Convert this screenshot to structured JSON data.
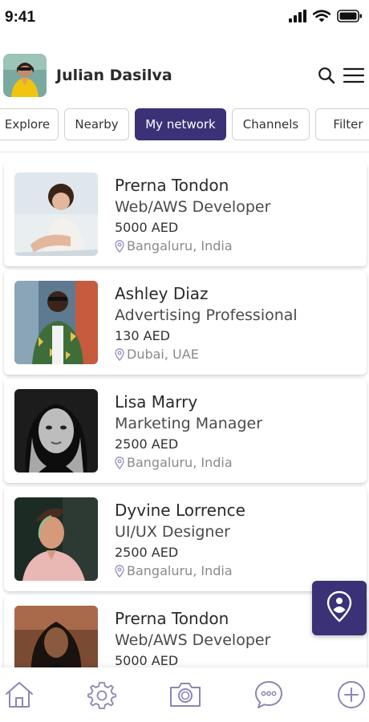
{
  "status_bar": {
    "time": "9:41"
  },
  "header": {
    "user_name": "Julian Dasilva",
    "icons": [
      "search-icon",
      "menu-icon"
    ]
  },
  "tabs": [
    {
      "label": "Explore",
      "active": false
    },
    {
      "label": "Nearby",
      "active": false
    },
    {
      "label": "My network",
      "active": true
    },
    {
      "label": "Channels",
      "active": false
    },
    {
      "label": "Filter",
      "active": false
    }
  ],
  "profiles": [
    {
      "name": "Prerna Tondon",
      "role": "Web/AWS Developer",
      "price": "5000 AED",
      "location": "Bangaluru, India"
    },
    {
      "name": "Ashley Diaz",
      "role": "Advertising Professional",
      "price": "130 AED",
      "location": "Dubai, UAE"
    },
    {
      "name": "Lisa Marry",
      "role": "Marketing Manager",
      "price": "2500 AED",
      "location": "Bangaluru, India"
    },
    {
      "name": "Dyvine Lorrence",
      "role": "UI/UX Designer",
      "price": "2500 AED",
      "location": "Bangaluru, India"
    },
    {
      "name": "Prerna Tondon",
      "role": "Web/AWS Developer",
      "price": "5000 AED",
      "location": ""
    }
  ],
  "bottom_nav": [
    "home-icon",
    "settings-icon",
    "camera-icon",
    "chat-icon",
    "add-icon"
  ],
  "colors": {
    "accent": "#3a3177",
    "nav_icon": "#8f84b8"
  }
}
